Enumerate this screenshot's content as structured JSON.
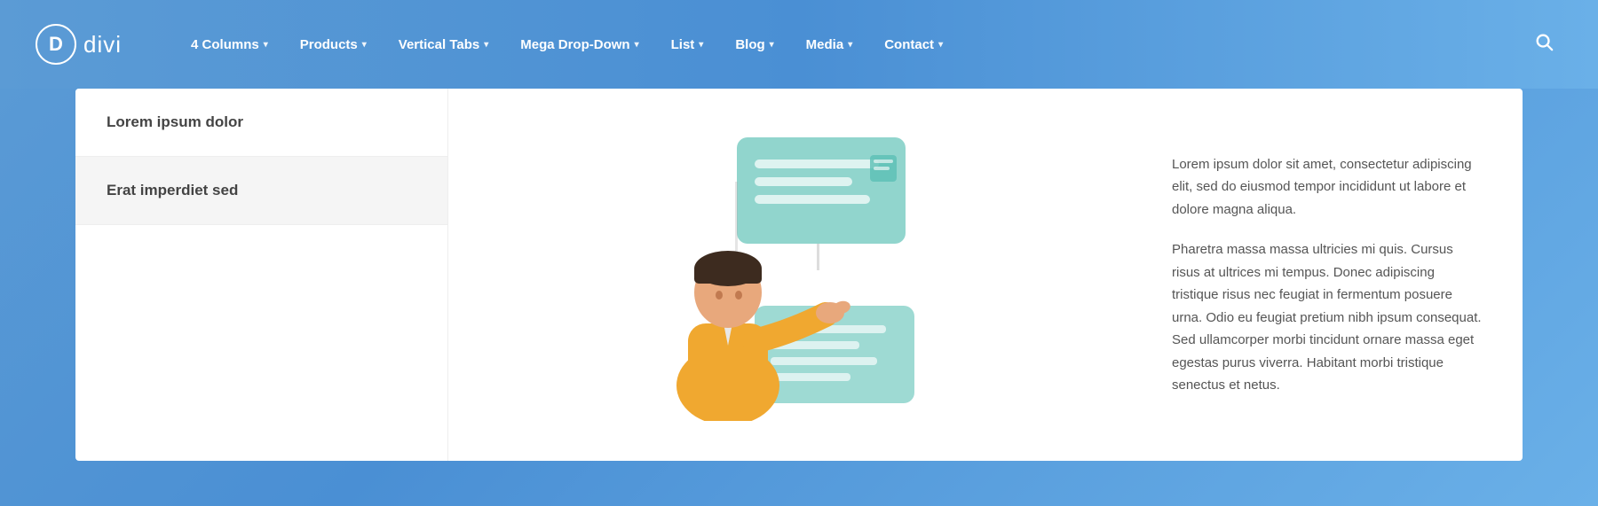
{
  "logo": {
    "letter": "D",
    "name": "divi"
  },
  "nav": {
    "items": [
      {
        "label": "4 Columns",
        "has_dropdown": true
      },
      {
        "label": "Products",
        "has_dropdown": true
      },
      {
        "label": "Vertical Tabs",
        "has_dropdown": true
      },
      {
        "label": "Mega Drop-Down",
        "has_dropdown": true
      },
      {
        "label": "List",
        "has_dropdown": true
      },
      {
        "label": "Blog",
        "has_dropdown": true
      },
      {
        "label": "Media",
        "has_dropdown": true
      },
      {
        "label": "Contact",
        "has_dropdown": true
      }
    ]
  },
  "sidebar": {
    "items": [
      {
        "label": "Lorem ipsum dolor"
      },
      {
        "label": "Erat imperdiet sed"
      }
    ]
  },
  "text_content": {
    "paragraph1": "Lorem ipsum dolor sit amet, consectetur adipiscing elit, sed do eiusmod tempor incididunt ut labore et dolore magna aliqua.",
    "paragraph2": "Pharetra massa massa ultricies mi quis. Cursus risus at ultrices mi tempus. Donec adipiscing tristique risus nec feugiat in fermentum posuere urna. Odio eu feugiat pretium nibh ipsum consequat. Sed ullamcorper morbi tincidunt ornare massa eget egestas purus viverra. Habitant morbi tristique senectus et netus."
  },
  "colors": {
    "header_gradient_start": "#5b9bd5",
    "header_gradient_end": "#6ab0e8",
    "nav_text": "#ffffff",
    "card_bg": "#ffffff",
    "sidebar_alt_bg": "#f5f5f5",
    "text_primary": "#444444",
    "text_body": "#555555",
    "teal_light": "#7ecec4",
    "teal_mid": "#5bbfb5",
    "person_skin": "#e8a87c",
    "person_hair": "#3d2b1f",
    "person_shirt": "#f0a830"
  }
}
